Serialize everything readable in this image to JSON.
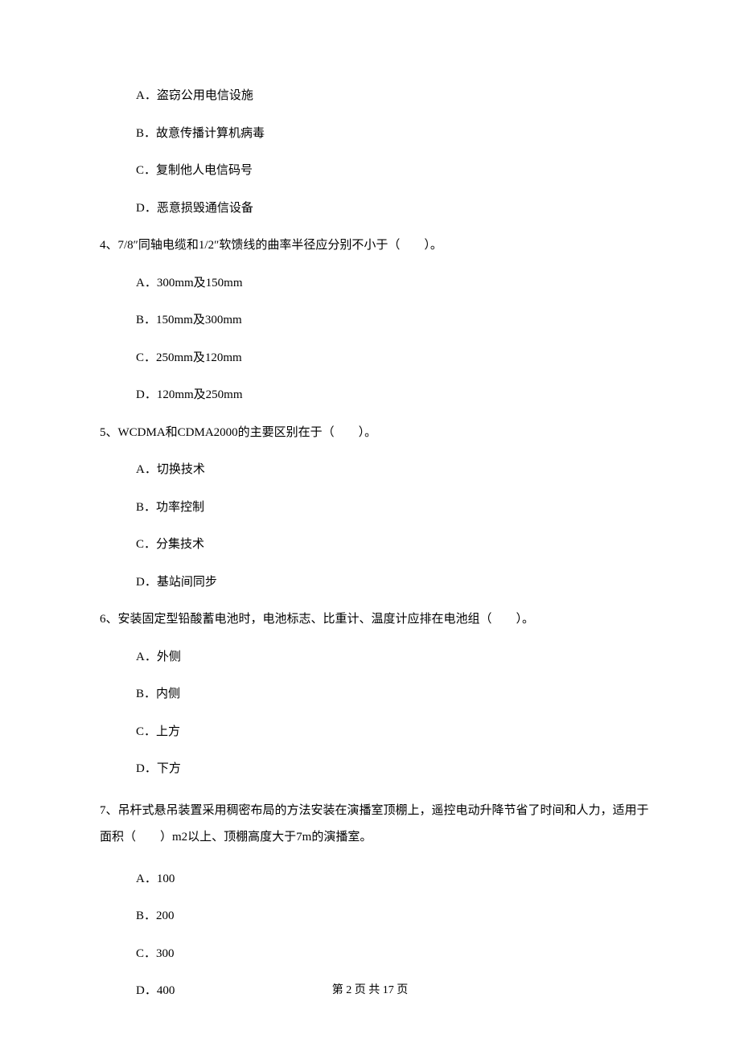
{
  "q3": {
    "options": {
      "a": "A．盗窃公用电信设施",
      "b": "B．故意传播计算机病毒",
      "c": "C．复制他人电信码号",
      "d": "D．恶意损毁通信设备"
    }
  },
  "q4": {
    "text": "4、7/8″同轴电缆和1/2″软馈线的曲率半径应分别不小于（　　）。",
    "options": {
      "a": "A．300mm及150mm",
      "b": "B．150mm及300mm",
      "c": "C．250mm及120mm",
      "d": "D．120mm及250mm"
    }
  },
  "q5": {
    "text": "5、WCDMA和CDMA2000的主要区别在于（　　）。",
    "options": {
      "a": "A．切换技术",
      "b": "B．功率控制",
      "c": "C．分集技术",
      "d": "D．基站间同步"
    }
  },
  "q6": {
    "text": "6、安装固定型铅酸蓄电池时，电池标志、比重计、温度计应排在电池组（　　）。",
    "options": {
      "a": "A．外侧",
      "b": "B．内侧",
      "c": "C．上方",
      "d": "D．下方"
    }
  },
  "q7": {
    "text": "7、吊杆式悬吊装置采用稠密布局的方法安装在演播室顶棚上，遥控电动升降节省了时间和人力，适用于面积（　　）m2以上、顶棚高度大于7m的演播室。",
    "options": {
      "a": "A．100",
      "b": "B．200",
      "c": "C．300",
      "d": "D．400"
    }
  },
  "footer": "第 2 页 共 17 页"
}
